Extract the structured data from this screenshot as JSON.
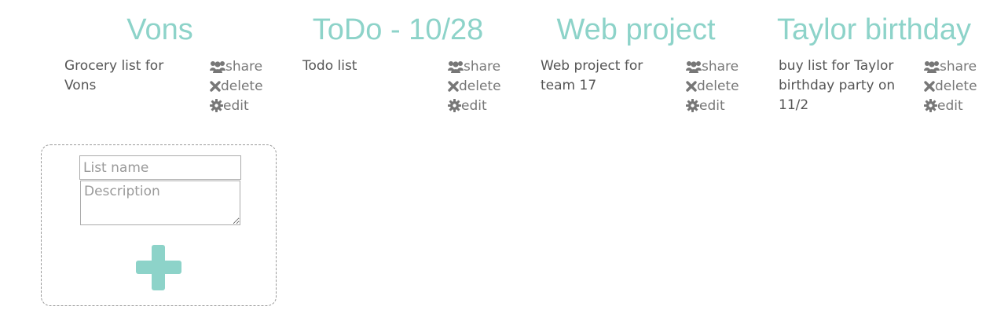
{
  "lists": [
    {
      "title": "Vons",
      "description": "Grocery list for Vons",
      "actions": {
        "share": "share",
        "delete": "delete",
        "edit": "edit"
      }
    },
    {
      "title": "ToDo - 10/28",
      "description": "Todo list",
      "actions": {
        "share": "share",
        "delete": "delete",
        "edit": "edit"
      }
    },
    {
      "title": "Web project",
      "description": "Web project for team 17",
      "actions": {
        "share": "share",
        "delete": "delete",
        "edit": "edit"
      }
    },
    {
      "title": "Taylor birthday",
      "description": "buy list for Taylor birthday party on 11/2",
      "actions": {
        "share": "share",
        "delete": "delete",
        "edit": "edit"
      }
    }
  ],
  "new_list": {
    "name_placeholder": "List name",
    "description_placeholder": "Description"
  },
  "icons": {
    "share": "users-icon",
    "delete": "x-icon",
    "edit": "gear-icon",
    "add": "plus-icon"
  },
  "colors": {
    "accent": "#8dd3c9",
    "text": "#555555",
    "action_text": "#777777"
  }
}
